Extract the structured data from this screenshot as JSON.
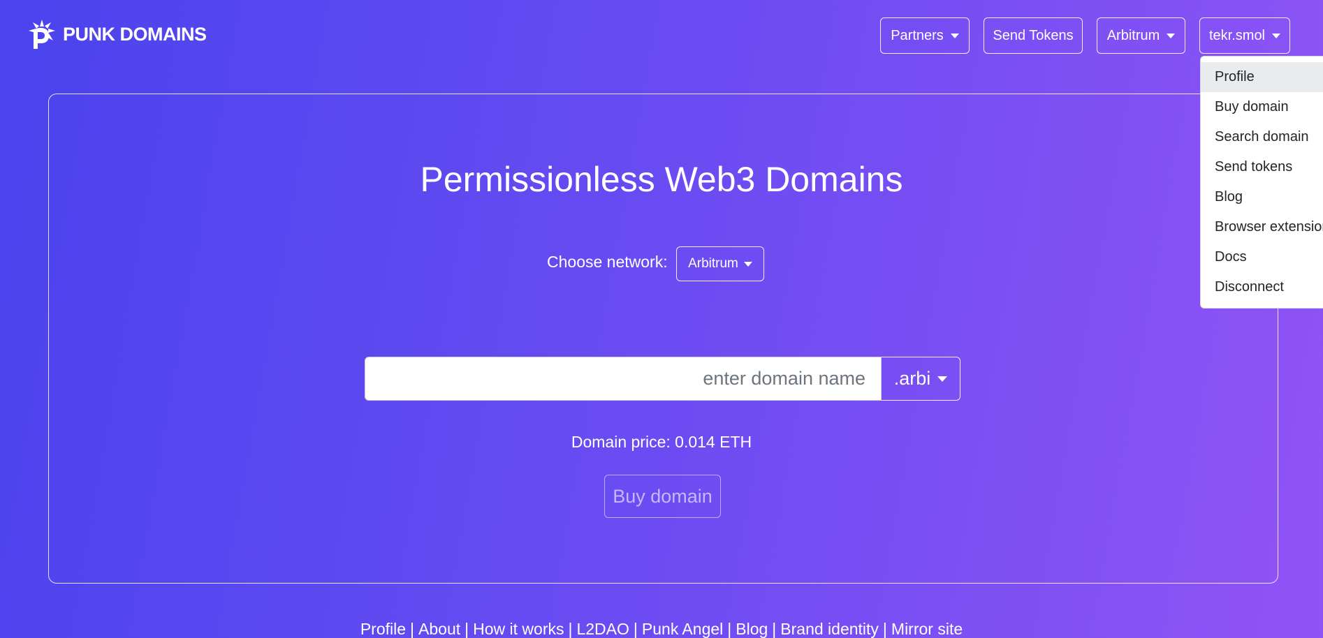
{
  "brand": {
    "name": "PUNK DOMAINS",
    "icon": "punk-logo-icon"
  },
  "nav": {
    "partners_label": "Partners",
    "send_tokens_label": "Send Tokens",
    "network_label": "Arbitrum",
    "account_label": "tekr.smol"
  },
  "account_menu": {
    "items": [
      "Profile",
      "Buy domain",
      "Search domain",
      "Send tokens",
      "Blog",
      "Browser extension",
      "Docs",
      "Disconnect"
    ],
    "active_item": "Profile"
  },
  "main": {
    "title": "Permissionless Web3 Domains",
    "choose_network_label": "Choose network:",
    "network_value": "Arbitrum",
    "domain_input_placeholder": "enter domain name",
    "tld_value": ".arbi",
    "price_text": "Domain price: 0.014 ETH",
    "buy_button_label": "Buy domain"
  },
  "footer": {
    "links": [
      "Profile",
      "About",
      "How it works",
      "L2DAO",
      "Punk Angel",
      "Blog",
      "Brand identity",
      "Mirror site"
    ],
    "separator": "|"
  },
  "colors": {
    "gradient_start": "#4a43ee",
    "gradient_end": "#9153f6",
    "menu_active_bg": "#e9ecef"
  }
}
